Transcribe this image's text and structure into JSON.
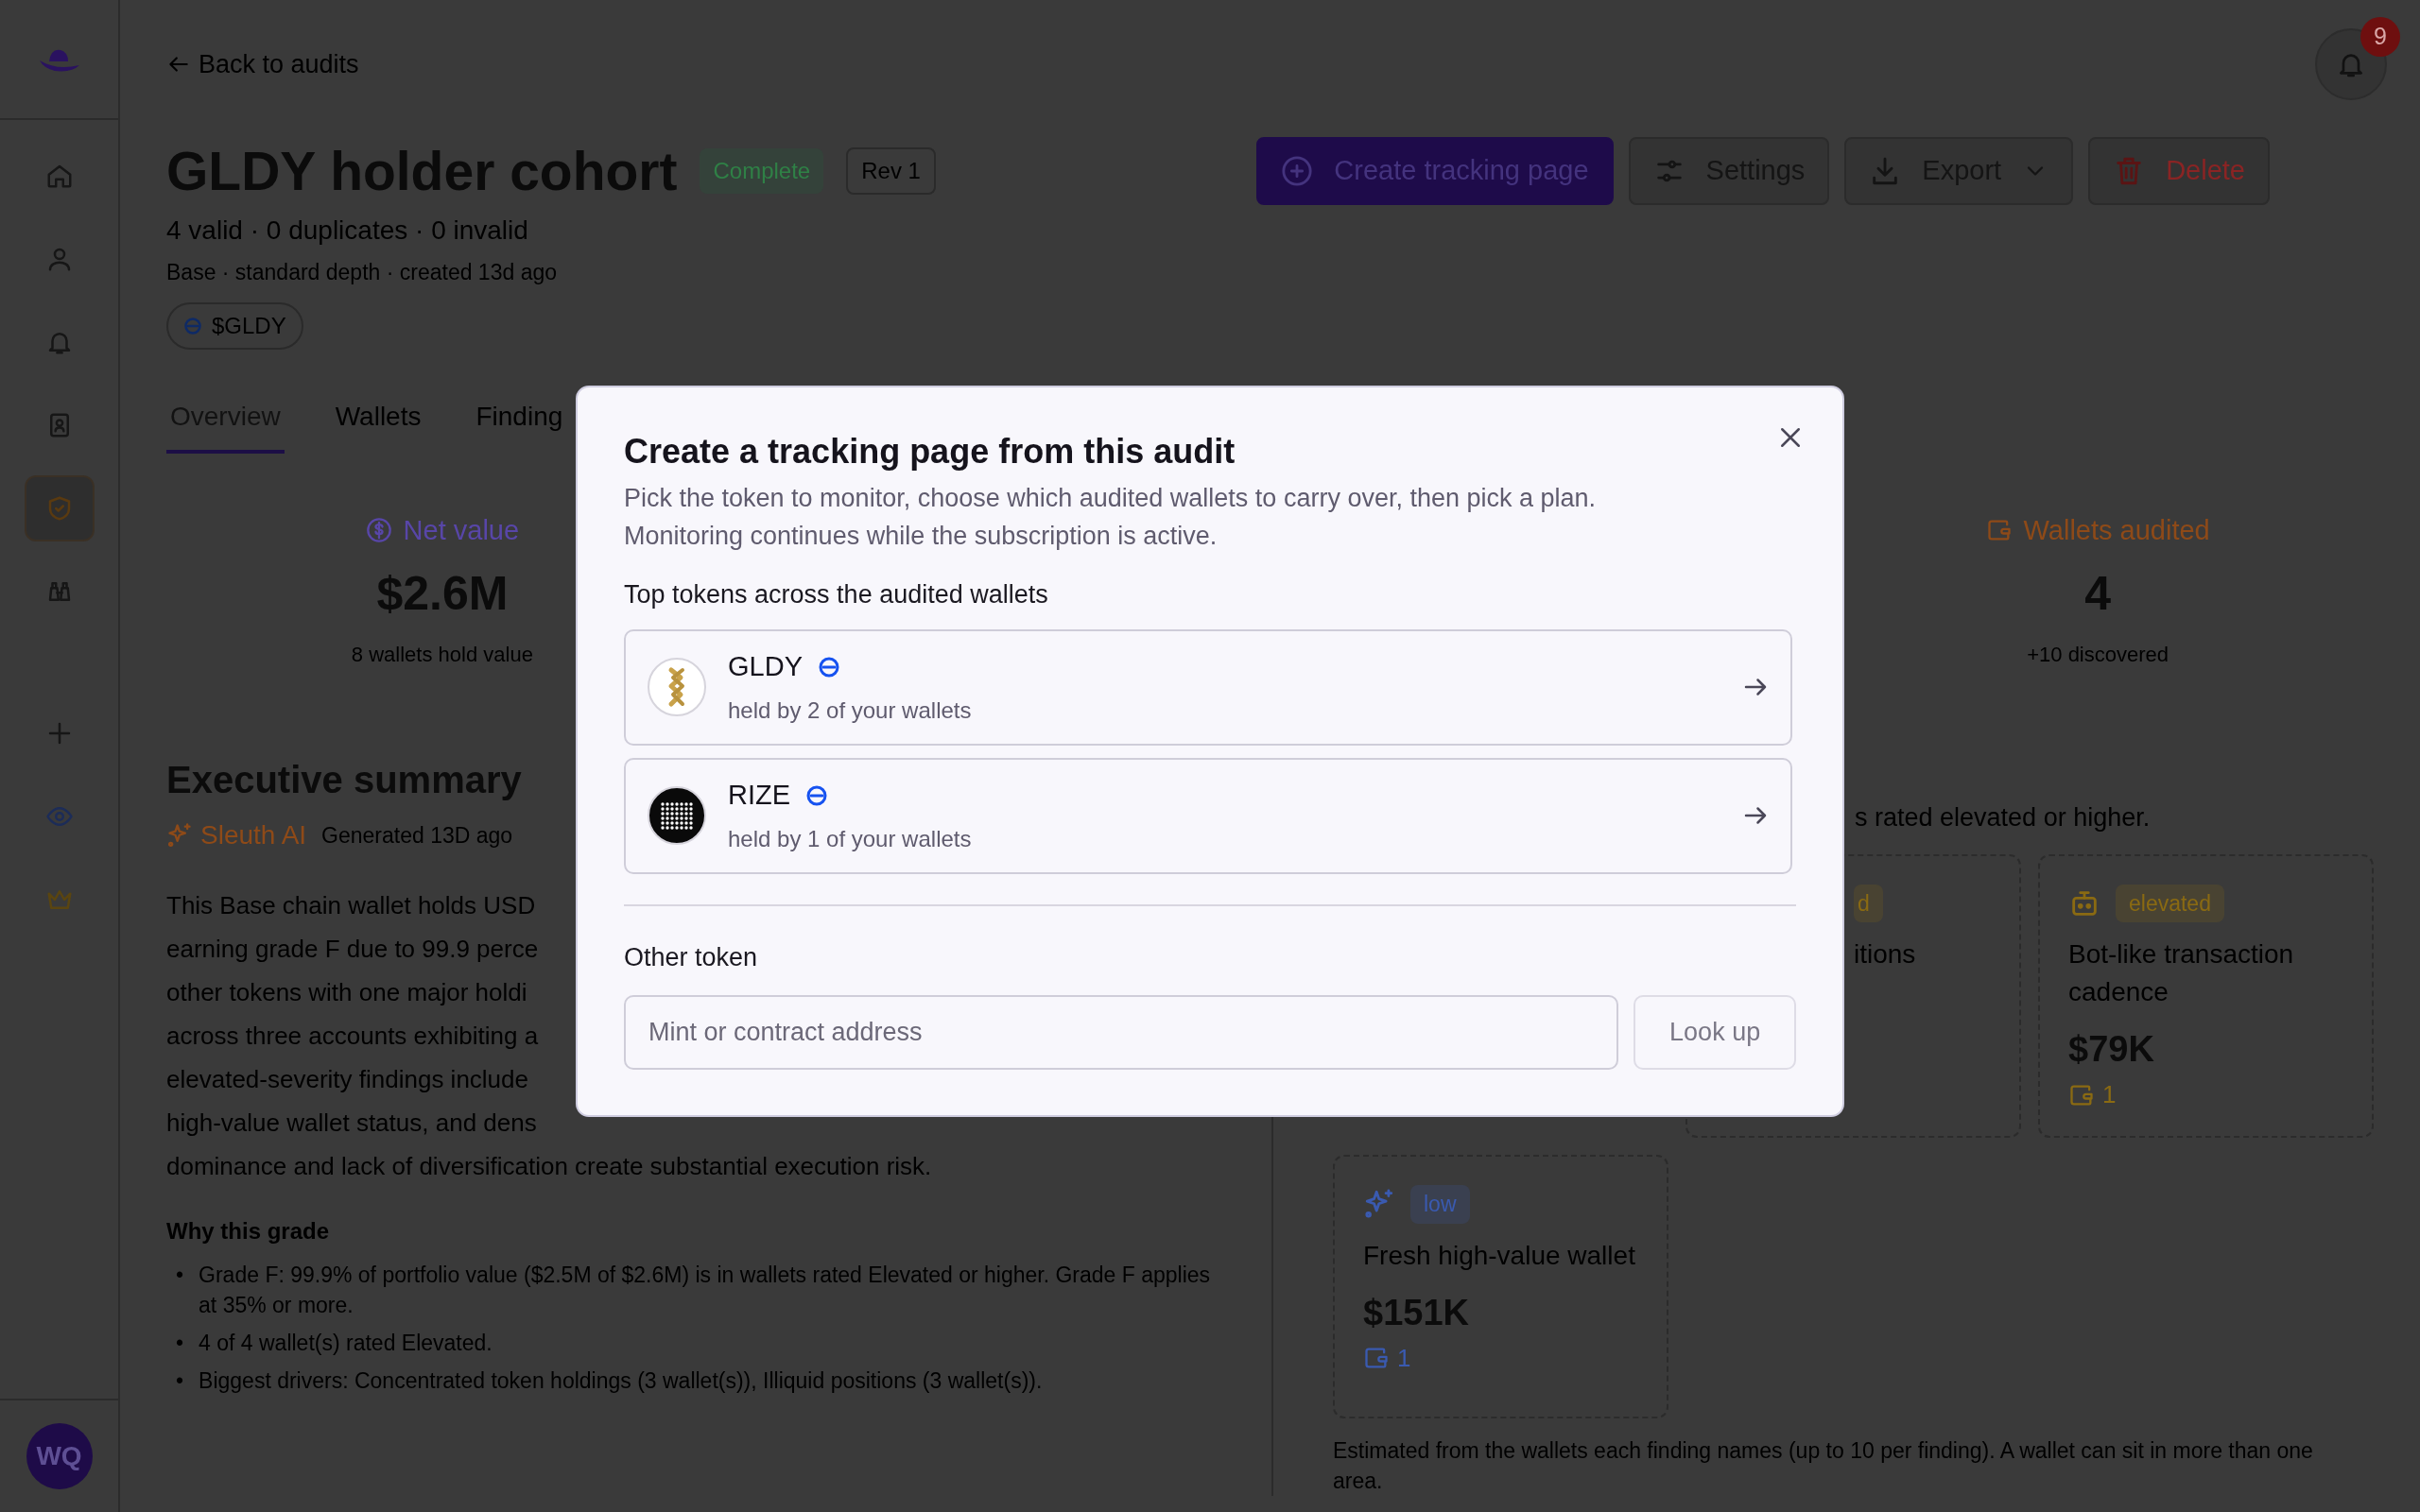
{
  "sidebar": {
    "items": [
      {
        "selected": false
      },
      {
        "selected": false
      },
      {
        "selected": false
      },
      {
        "selected": false
      },
      {
        "selected": true
      },
      {
        "selected": false
      }
    ],
    "extras": [
      {
        "selected": false
      },
      {
        "selected": false
      },
      {
        "selected": false
      }
    ],
    "avatar": "WQ"
  },
  "notifications": {
    "count": "9"
  },
  "back_link": "Back to audits",
  "audit": {
    "title": "GLDY holder cohort",
    "status": "Complete",
    "revision": "Rev 1",
    "counts": "4 valid · 0 duplicates · 0 invalid",
    "meta": "Base · standard depth · created 13d ago",
    "token_chip": "$GLDY"
  },
  "actions": [
    {
      "label": "Create tracking page",
      "kind": "primary"
    },
    {
      "label": "Settings",
      "kind": "default"
    },
    {
      "label": "Export",
      "kind": "dropdown"
    },
    {
      "label": "Delete",
      "kind": "danger"
    }
  ],
  "tabs": [
    {
      "label": "Overview",
      "selected": true
    },
    {
      "label": "Wallets",
      "selected": false
    },
    {
      "label": "Finding",
      "selected": false
    }
  ],
  "stats": [
    {
      "label": "Net value",
      "value": "$2.6M",
      "note": "8 wallets hold value",
      "color": "#5846a8"
    },
    {
      "label": "Wallets audited",
      "value": "4",
      "note": "+10 discovered",
      "color": "#8e4a18"
    }
  ],
  "summary": {
    "title": "Executive summary",
    "source": "Sleuth AI",
    "generated": "Generated 13D ago",
    "lines": [
      "This Base chain wallet holds USD",
      "earning grade F due to 99.9 perce",
      "other tokens with one major holdi",
      "across three accounts exhibiting a",
      "elevated-severity findings include",
      "high-value wallet status, and dens",
      "dominance and lack of diversification create substantial execution risk."
    ],
    "why_title": "Why this grade",
    "marker": "•",
    "bullets": [
      "Grade F: 99.9% of portfolio value ($2.5M of $2.6M) is in wallets rated Elevated or higher. Grade F applies at 35% or more.",
      "4 of 4 wallet(s) rated Elevated.",
      "Biggest drivers: Concentrated token holdings (3 wallet(s)), Illiquid positions (3 wallet(s))."
    ]
  },
  "risk": {
    "intro": "s rated elevated or higher.",
    "cards": [
      {
        "kind": "clipped",
        "badge": "d",
        "title": "itions",
        "color": "#8a6a12"
      },
      {
        "kind": "finding",
        "badge": "elevated",
        "title": "Bot-like transaction cadence",
        "value": "$79K",
        "wallets": "1",
        "color": "#8a6a12"
      },
      {
        "kind": "finding",
        "badge": "low",
        "title": "Fresh high-value wallet",
        "value": "$151K",
        "wallets": "1",
        "color": "#3a5ab0"
      }
    ],
    "footnote": "Estimated from the wallets each finding names (up to 10 per finding). A wallet can sit in more than one area."
  },
  "modal": {
    "title": "Create a tracking page from this audit",
    "description": "Pick the token to monitor, choose which audited wallets to carry over, then pick a plan. Monitoring continues while the subscription is active.",
    "tokens_title": "Top tokens across the audited wallets",
    "tokens": [
      {
        "name": "GLDY",
        "held": "held by 2 of your wallets"
      },
      {
        "name": "RIZE",
        "held": "held by 1 of your wallets"
      }
    ],
    "other_title": "Other token",
    "input": {
      "placeholder": "Mint or contract address"
    },
    "lookup": {
      "label": "Look up",
      "disabled": true
    }
  }
}
